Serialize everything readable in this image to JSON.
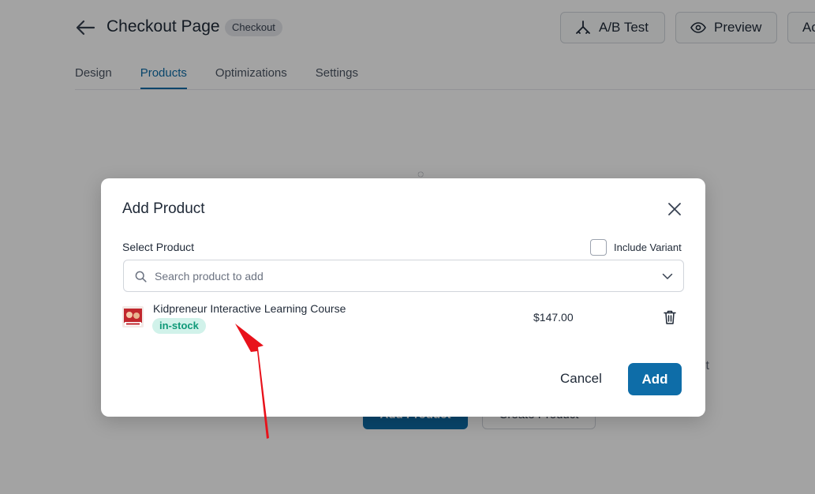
{
  "header": {
    "title": "Checkout Page",
    "badge": "Checkout",
    "ab_test_label": "A/B Test",
    "preview_label": "Preview",
    "more_label": "Ac"
  },
  "tabs": [
    {
      "label": "Design"
    },
    {
      "label": "Products"
    },
    {
      "label": "Optimizations"
    },
    {
      "label": "Settings"
    }
  ],
  "background": {
    "empty_text_fragment": "ıt",
    "add_product_label": "Add Product",
    "create_product_label": "Create Product"
  },
  "modal": {
    "title": "Add Product",
    "select_label": "Select Product",
    "include_variant_label": "Include Variant",
    "search_placeholder": "Search product to add",
    "product": {
      "name": "Kidpreneur Interactive Learning Course",
      "stock": "in-stock",
      "price": "$147.00"
    },
    "cancel_label": "Cancel",
    "add_label": "Add"
  },
  "colors": {
    "primary": "#0e6da8",
    "stock_bg": "#d1f2ea",
    "stock_text": "#0f9978",
    "arrow": "#e8121b"
  },
  "icons": [
    "back-arrow-icon",
    "ab-test-icon",
    "eye-icon",
    "close-icon",
    "search-icon",
    "chevron-down-icon",
    "trash-icon"
  ]
}
